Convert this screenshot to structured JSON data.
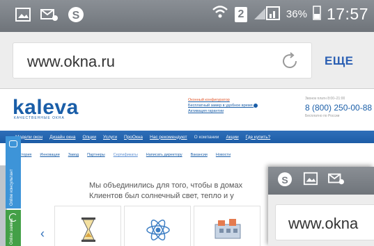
{
  "status_bar": {
    "battery_percent": "36%",
    "time": "17:57",
    "sim_slot": "2",
    "icons": [
      "gallery-icon",
      "mail-icon",
      "skype-icon",
      "wifi-icon",
      "signal-icon",
      "battery-icon"
    ]
  },
  "browser": {
    "url": "www.okna.ru",
    "more_label": "ЕЩЕ"
  },
  "site": {
    "logo": "kaleva",
    "logo_sub": "КАЧЕСТВЕННЫЕ ОКНА",
    "promo": [
      "Оконный конфигуратор",
      "Бесплатный замер в удобное время",
      "Активация гарантии"
    ],
    "phone_hint": "Звонок платн 8:00–21:00",
    "phone": "8 (800) 250-00-88",
    "phone_note": "Бесплатно по России",
    "nav": [
      "Модели окон",
      "Дизайн окна",
      "Опции",
      "Услуги",
      "ПроОкна",
      "Нас рекомендуют",
      "О компании",
      "Акции",
      "Где купить?"
    ],
    "subnav": [
      "стория",
      "Инновации",
      "Завод",
      "Партнеры",
      "Сертификаты",
      "Написать директору",
      "Вакансии",
      "Новости"
    ],
    "intro_line1": "Мы объединились для того, чтобы в домах",
    "intro_line2": "Клиентов был солнечный свет, тепло и у",
    "side_tab_blue": "Online консультант",
    "side_tab_green": "Online заявка"
  },
  "overlay": {
    "url": "www.okna"
  },
  "colors": {
    "brand_blue": "#1a5ea8",
    "nav_blue": "#2f6fb9",
    "accent_link": "#2b5fb3",
    "status_bar": "#7a7f85"
  }
}
